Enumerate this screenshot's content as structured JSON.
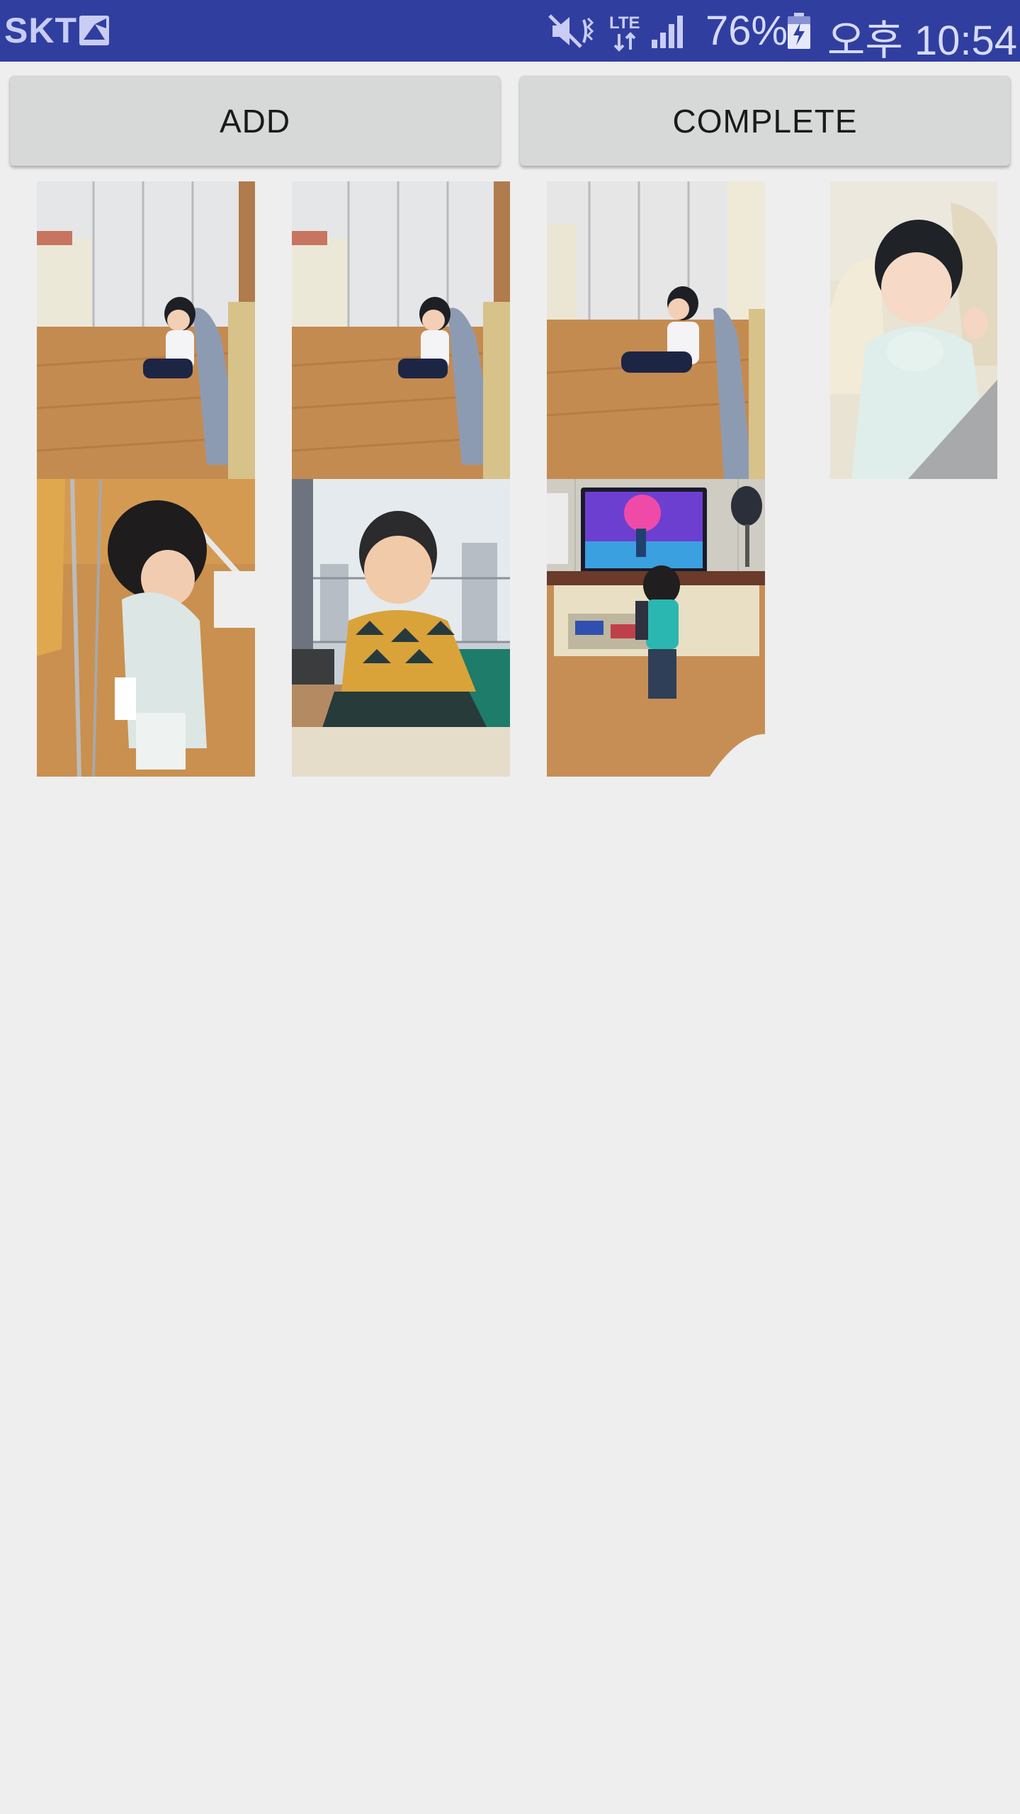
{
  "status_bar": {
    "carrier": "SKT",
    "battery_percent": "76%",
    "time": "오후 10:54",
    "network": "LTE",
    "icons": [
      "picture-icon",
      "mute-icon",
      "lte-icon",
      "signal-icon",
      "battery-charging-icon"
    ]
  },
  "toolbar": {
    "add_label": "ADD",
    "complete_label": "COMPLETE"
  },
  "gallery": {
    "photos": [
      {
        "scene": "baby-sitting-floor"
      },
      {
        "scene": "baby-sitting-floor"
      },
      {
        "scene": "baby-sitting-floor-looking-away"
      },
      {
        "scene": "baby-on-sofa"
      },
      {
        "scene": "baby-standing-at-rack"
      },
      {
        "scene": "baby-sitting-window"
      },
      {
        "scene": "baby-watching-tv"
      }
    ]
  },
  "colors": {
    "status_bar": "#303f9f",
    "background": "#eeeeef",
    "button": "#d7d8d8"
  }
}
